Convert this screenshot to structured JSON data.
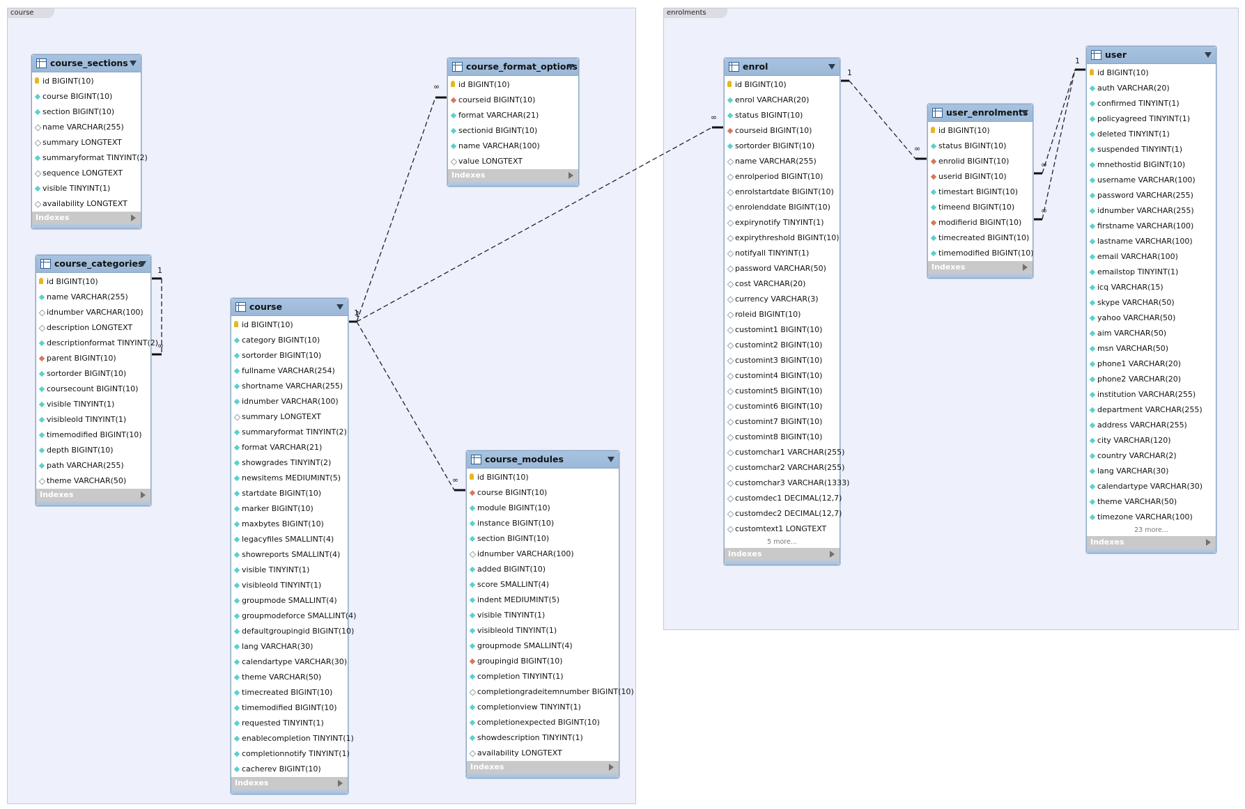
{
  "layers": [
    {
      "id": "course",
      "label": "course"
    },
    {
      "id": "enrolments",
      "label": "enrolments"
    }
  ],
  "index_label": "Indexes",
  "tables": [
    {
      "id": "course_sections",
      "title": "course_sections",
      "columns": [
        {
          "name": "id BIGINT(10)",
          "kind": "pk"
        },
        {
          "name": "course BIGINT(10)",
          "kind": "nn"
        },
        {
          "name": "section BIGINT(10)",
          "kind": "nn"
        },
        {
          "name": "name VARCHAR(255)",
          "kind": "nul"
        },
        {
          "name": "summary LONGTEXT",
          "kind": "nul"
        },
        {
          "name": "summaryformat TINYINT(2)",
          "kind": "nn"
        },
        {
          "name": "sequence LONGTEXT",
          "kind": "nul"
        },
        {
          "name": "visible TINYINT(1)",
          "kind": "nn"
        },
        {
          "name": "availability LONGTEXT",
          "kind": "nul"
        }
      ]
    },
    {
      "id": "course_categories",
      "title": "course_categories",
      "columns": [
        {
          "name": "id BIGINT(10)",
          "kind": "pk"
        },
        {
          "name": "name VARCHAR(255)",
          "kind": "nn"
        },
        {
          "name": "idnumber VARCHAR(100)",
          "kind": "nul"
        },
        {
          "name": "description LONGTEXT",
          "kind": "nul"
        },
        {
          "name": "descriptionformat TINYINT(2)",
          "kind": "nn"
        },
        {
          "name": "parent BIGINT(10)",
          "kind": "fk"
        },
        {
          "name": "sortorder BIGINT(10)",
          "kind": "nn"
        },
        {
          "name": "coursecount BIGINT(10)",
          "kind": "nn"
        },
        {
          "name": "visible TINYINT(1)",
          "kind": "nn"
        },
        {
          "name": "visibleold TINYINT(1)",
          "kind": "nn"
        },
        {
          "name": "timemodified BIGINT(10)",
          "kind": "nn"
        },
        {
          "name": "depth BIGINT(10)",
          "kind": "nn"
        },
        {
          "name": "path VARCHAR(255)",
          "kind": "nn"
        },
        {
          "name": "theme VARCHAR(50)",
          "kind": "nul"
        }
      ]
    },
    {
      "id": "course",
      "title": "course",
      "columns": [
        {
          "name": "id BIGINT(10)",
          "kind": "pk"
        },
        {
          "name": "category BIGINT(10)",
          "kind": "nn"
        },
        {
          "name": "sortorder BIGINT(10)",
          "kind": "nn"
        },
        {
          "name": "fullname VARCHAR(254)",
          "kind": "nn"
        },
        {
          "name": "shortname VARCHAR(255)",
          "kind": "nn"
        },
        {
          "name": "idnumber VARCHAR(100)",
          "kind": "nn"
        },
        {
          "name": "summary LONGTEXT",
          "kind": "nul"
        },
        {
          "name": "summaryformat TINYINT(2)",
          "kind": "nn"
        },
        {
          "name": "format VARCHAR(21)",
          "kind": "nn"
        },
        {
          "name": "showgrades TINYINT(2)",
          "kind": "nn"
        },
        {
          "name": "newsitems MEDIUMINT(5)",
          "kind": "nn"
        },
        {
          "name": "startdate BIGINT(10)",
          "kind": "nn"
        },
        {
          "name": "marker BIGINT(10)",
          "kind": "nn"
        },
        {
          "name": "maxbytes BIGINT(10)",
          "kind": "nn"
        },
        {
          "name": "legacyfiles SMALLINT(4)",
          "kind": "nn"
        },
        {
          "name": "showreports SMALLINT(4)",
          "kind": "nn"
        },
        {
          "name": "visible TINYINT(1)",
          "kind": "nn"
        },
        {
          "name": "visibleold TINYINT(1)",
          "kind": "nn"
        },
        {
          "name": "groupmode SMALLINT(4)",
          "kind": "nn"
        },
        {
          "name": "groupmodeforce SMALLINT(4)",
          "kind": "nn"
        },
        {
          "name": "defaultgroupingid BIGINT(10)",
          "kind": "nn"
        },
        {
          "name": "lang VARCHAR(30)",
          "kind": "nn"
        },
        {
          "name": "calendartype VARCHAR(30)",
          "kind": "nn"
        },
        {
          "name": "theme VARCHAR(50)",
          "kind": "nn"
        },
        {
          "name": "timecreated BIGINT(10)",
          "kind": "nn"
        },
        {
          "name": "timemodified BIGINT(10)",
          "kind": "nn"
        },
        {
          "name": "requested TINYINT(1)",
          "kind": "nn"
        },
        {
          "name": "enablecompletion TINYINT(1)",
          "kind": "nn"
        },
        {
          "name": "completionnotify TINYINT(1)",
          "kind": "nn"
        },
        {
          "name": "cacherev BIGINT(10)",
          "kind": "nn"
        }
      ]
    },
    {
      "id": "course_format_options",
      "title": "course_format_options",
      "columns": [
        {
          "name": "id BIGINT(10)",
          "kind": "pk"
        },
        {
          "name": "courseid BIGINT(10)",
          "kind": "fk"
        },
        {
          "name": "format VARCHAR(21)",
          "kind": "nn"
        },
        {
          "name": "sectionid BIGINT(10)",
          "kind": "nn"
        },
        {
          "name": "name VARCHAR(100)",
          "kind": "nn"
        },
        {
          "name": "value LONGTEXT",
          "kind": "nul"
        }
      ]
    },
    {
      "id": "course_modules",
      "title": "course_modules",
      "columns": [
        {
          "name": "id BIGINT(10)",
          "kind": "pk"
        },
        {
          "name": "course BIGINT(10)",
          "kind": "fk"
        },
        {
          "name": "module BIGINT(10)",
          "kind": "nn"
        },
        {
          "name": "instance BIGINT(10)",
          "kind": "nn"
        },
        {
          "name": "section BIGINT(10)",
          "kind": "nn"
        },
        {
          "name": "idnumber VARCHAR(100)",
          "kind": "nul"
        },
        {
          "name": "added BIGINT(10)",
          "kind": "nn"
        },
        {
          "name": "score SMALLINT(4)",
          "kind": "nn"
        },
        {
          "name": "indent MEDIUMINT(5)",
          "kind": "nn"
        },
        {
          "name": "visible TINYINT(1)",
          "kind": "nn"
        },
        {
          "name": "visibleold TINYINT(1)",
          "kind": "nn"
        },
        {
          "name": "groupmode SMALLINT(4)",
          "kind": "nn"
        },
        {
          "name": "groupingid BIGINT(10)",
          "kind": "fk"
        },
        {
          "name": "completion TINYINT(1)",
          "kind": "nn"
        },
        {
          "name": "completiongradeitemnumber BIGINT(10)",
          "kind": "nul"
        },
        {
          "name": "completionview TINYINT(1)",
          "kind": "nn"
        },
        {
          "name": "completionexpected BIGINT(10)",
          "kind": "nn"
        },
        {
          "name": "showdescription TINYINT(1)",
          "kind": "nn"
        },
        {
          "name": "availability LONGTEXT",
          "kind": "nul"
        }
      ]
    },
    {
      "id": "enrol",
      "title": "enrol",
      "more": "5 more...",
      "columns": [
        {
          "name": "id BIGINT(10)",
          "kind": "pk"
        },
        {
          "name": "enrol VARCHAR(20)",
          "kind": "nn"
        },
        {
          "name": "status BIGINT(10)",
          "kind": "nn"
        },
        {
          "name": "courseid BIGINT(10)",
          "kind": "fk"
        },
        {
          "name": "sortorder BIGINT(10)",
          "kind": "nn"
        },
        {
          "name": "name VARCHAR(255)",
          "kind": "nul"
        },
        {
          "name": "enrolperiod BIGINT(10)",
          "kind": "nul"
        },
        {
          "name": "enrolstartdate BIGINT(10)",
          "kind": "nul"
        },
        {
          "name": "enrolenddate BIGINT(10)",
          "kind": "nul"
        },
        {
          "name": "expirynotify TINYINT(1)",
          "kind": "nul"
        },
        {
          "name": "expirythreshold BIGINT(10)",
          "kind": "nul"
        },
        {
          "name": "notifyall TINYINT(1)",
          "kind": "nul"
        },
        {
          "name": "password VARCHAR(50)",
          "kind": "nul"
        },
        {
          "name": "cost VARCHAR(20)",
          "kind": "nul"
        },
        {
          "name": "currency VARCHAR(3)",
          "kind": "nul"
        },
        {
          "name": "roleid BIGINT(10)",
          "kind": "nul"
        },
        {
          "name": "customint1 BIGINT(10)",
          "kind": "nul"
        },
        {
          "name": "customint2 BIGINT(10)",
          "kind": "nul"
        },
        {
          "name": "customint3 BIGINT(10)",
          "kind": "nul"
        },
        {
          "name": "customint4 BIGINT(10)",
          "kind": "nul"
        },
        {
          "name": "customint5 BIGINT(10)",
          "kind": "nul"
        },
        {
          "name": "customint6 BIGINT(10)",
          "kind": "nul"
        },
        {
          "name": "customint7 BIGINT(10)",
          "kind": "nul"
        },
        {
          "name": "customint8 BIGINT(10)",
          "kind": "nul"
        },
        {
          "name": "customchar1 VARCHAR(255)",
          "kind": "nul"
        },
        {
          "name": "customchar2 VARCHAR(255)",
          "kind": "nul"
        },
        {
          "name": "customchar3 VARCHAR(1333)",
          "kind": "nul"
        },
        {
          "name": "customdec1 DECIMAL(12,7)",
          "kind": "nul"
        },
        {
          "name": "customdec2 DECIMAL(12,7)",
          "kind": "nul"
        },
        {
          "name": "customtext1 LONGTEXT",
          "kind": "nul"
        }
      ]
    },
    {
      "id": "user_enrolments",
      "title": "user_enrolments",
      "columns": [
        {
          "name": "id BIGINT(10)",
          "kind": "pk"
        },
        {
          "name": "status BIGINT(10)",
          "kind": "nn"
        },
        {
          "name": "enrolid BIGINT(10)",
          "kind": "fk"
        },
        {
          "name": "userid BIGINT(10)",
          "kind": "fk"
        },
        {
          "name": "timestart BIGINT(10)",
          "kind": "nn"
        },
        {
          "name": "timeend BIGINT(10)",
          "kind": "nn"
        },
        {
          "name": "modifierid BIGINT(10)",
          "kind": "fk"
        },
        {
          "name": "timecreated BIGINT(10)",
          "kind": "nn"
        },
        {
          "name": "timemodified BIGINT(10)",
          "kind": "nn"
        }
      ]
    },
    {
      "id": "user",
      "title": "user",
      "more": "23 more...",
      "columns": [
        {
          "name": "id BIGINT(10)",
          "kind": "pk"
        },
        {
          "name": "auth VARCHAR(20)",
          "kind": "nn"
        },
        {
          "name": "confirmed TINYINT(1)",
          "kind": "nn"
        },
        {
          "name": "policyagreed TINYINT(1)",
          "kind": "nn"
        },
        {
          "name": "deleted TINYINT(1)",
          "kind": "nn"
        },
        {
          "name": "suspended TINYINT(1)",
          "kind": "nn"
        },
        {
          "name": "mnethostid BIGINT(10)",
          "kind": "nn"
        },
        {
          "name": "username VARCHAR(100)",
          "kind": "nn"
        },
        {
          "name": "password VARCHAR(255)",
          "kind": "nn"
        },
        {
          "name": "idnumber VARCHAR(255)",
          "kind": "nn"
        },
        {
          "name": "firstname VARCHAR(100)",
          "kind": "nn"
        },
        {
          "name": "lastname VARCHAR(100)",
          "kind": "nn"
        },
        {
          "name": "email VARCHAR(100)",
          "kind": "nn"
        },
        {
          "name": "emailstop TINYINT(1)",
          "kind": "nn"
        },
        {
          "name": "icq VARCHAR(15)",
          "kind": "nn"
        },
        {
          "name": "skype VARCHAR(50)",
          "kind": "nn"
        },
        {
          "name": "yahoo VARCHAR(50)",
          "kind": "nn"
        },
        {
          "name": "aim VARCHAR(50)",
          "kind": "nn"
        },
        {
          "name": "msn VARCHAR(50)",
          "kind": "nn"
        },
        {
          "name": "phone1 VARCHAR(20)",
          "kind": "nn"
        },
        {
          "name": "phone2 VARCHAR(20)",
          "kind": "nn"
        },
        {
          "name": "institution VARCHAR(255)",
          "kind": "nn"
        },
        {
          "name": "department VARCHAR(255)",
          "kind": "nn"
        },
        {
          "name": "address VARCHAR(255)",
          "kind": "nn"
        },
        {
          "name": "city VARCHAR(120)",
          "kind": "nn"
        },
        {
          "name": "country VARCHAR(2)",
          "kind": "nn"
        },
        {
          "name": "lang VARCHAR(30)",
          "kind": "nn"
        },
        {
          "name": "calendartype VARCHAR(30)",
          "kind": "nn"
        },
        {
          "name": "theme VARCHAR(50)",
          "kind": "nn"
        },
        {
          "name": "timezone VARCHAR(100)",
          "kind": "nn"
        }
      ]
    }
  ],
  "relationships": [
    {
      "id": "categories-self",
      "one": "1",
      "many": "∞"
    },
    {
      "id": "course-format-options",
      "one": "1",
      "many": "∞"
    },
    {
      "id": "course-enrol",
      "one": "1",
      "many": "∞"
    },
    {
      "id": "course-modules",
      "one": "1",
      "many": "∞"
    },
    {
      "id": "enrol-user-enrolments",
      "one": "1",
      "many": "∞"
    },
    {
      "id": "user-user-enrolments-userid",
      "one": "1",
      "many": "∞"
    },
    {
      "id": "user-user-enrolments-modifierid",
      "one": "",
      "many": "∞"
    }
  ],
  "colors": {
    "header": "#9bb8d8",
    "canvas": "#eef0fb",
    "pk": "#e5b81c",
    "fk": "#d7775e",
    "notnull": "#5bd0cf"
  }
}
